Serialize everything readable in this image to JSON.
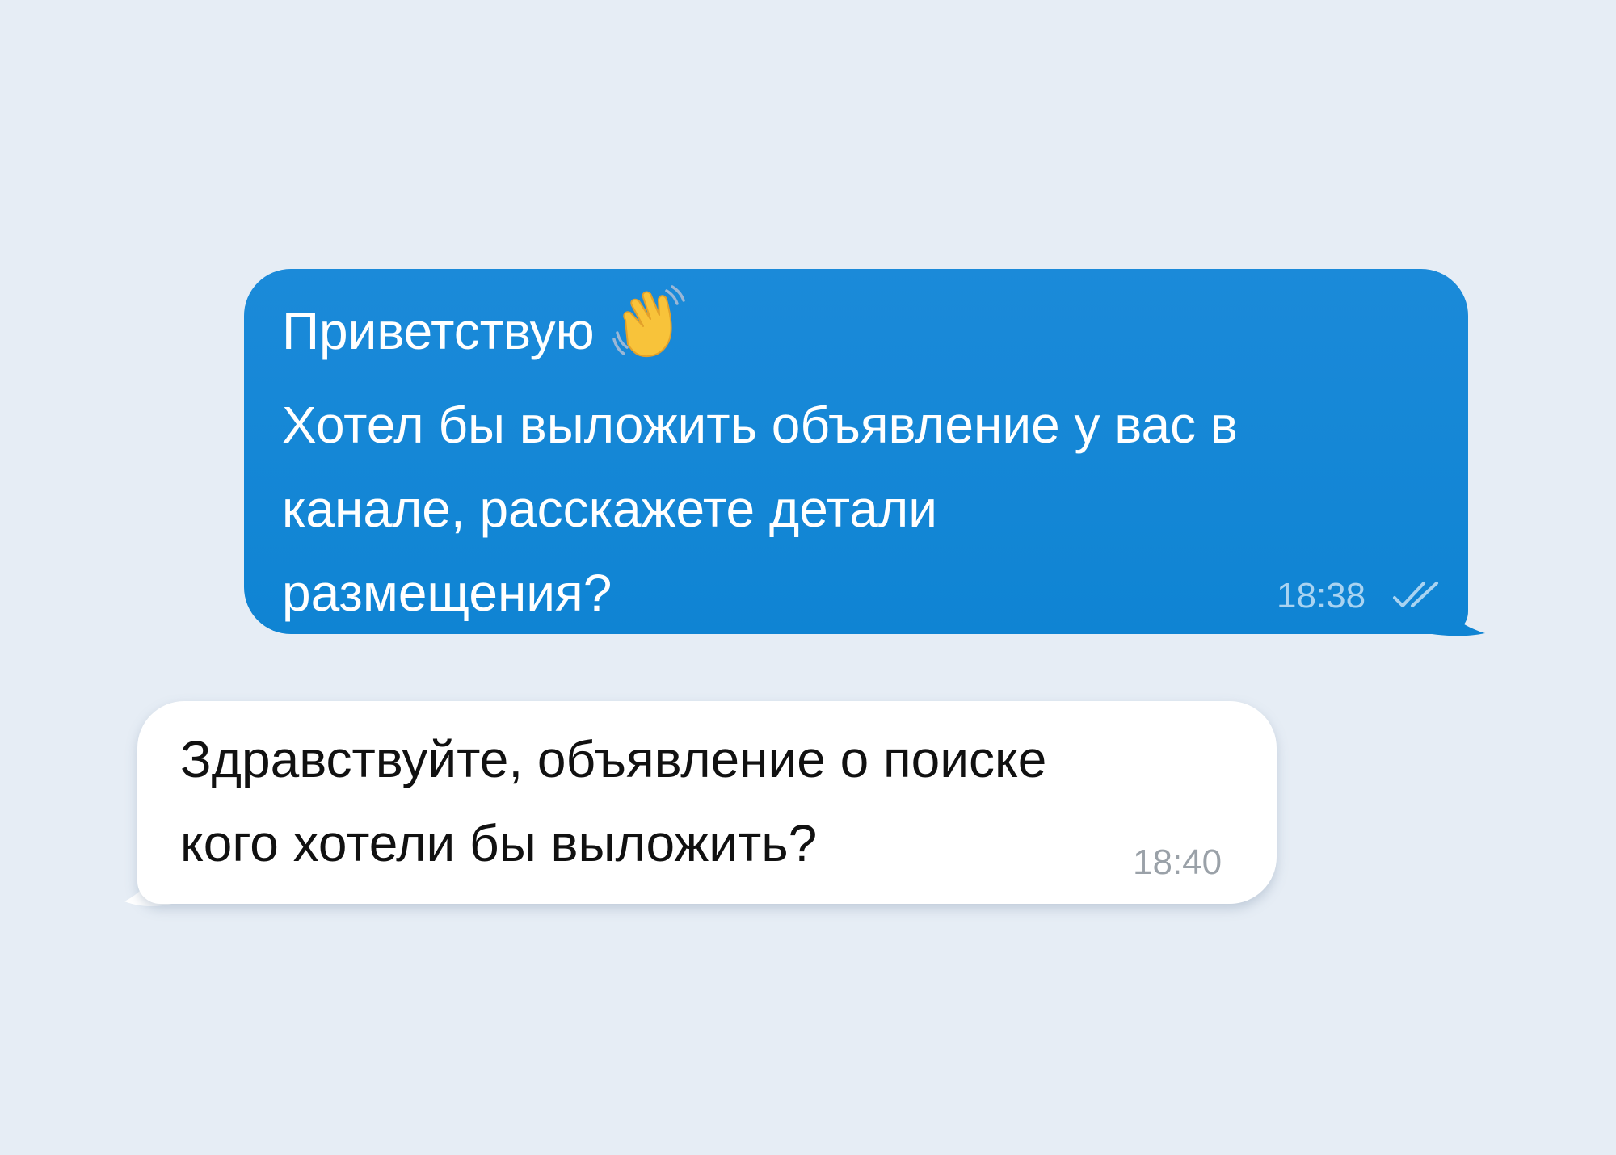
{
  "colors": {
    "background": "#e6edf5",
    "outgoing_bubble": "#1388d6",
    "incoming_bubble": "#ffffff",
    "outgoing_meta": "#a9d3f1",
    "incoming_meta": "#9aa1a8"
  },
  "messages": {
    "outgoing": {
      "lines": [
        "Приветствую",
        "Хотел бы выложить объявление у вас в",
        "канале, расскажете детали",
        "размещения?"
      ],
      "emoji_icon": "waving-hand-icon",
      "time": "18:38",
      "status_icon": "double-check-icon"
    },
    "incoming": {
      "lines": [
        "Здравствуйте, объявление о поиске",
        "кого хотели бы выложить?"
      ],
      "time": "18:40"
    }
  }
}
